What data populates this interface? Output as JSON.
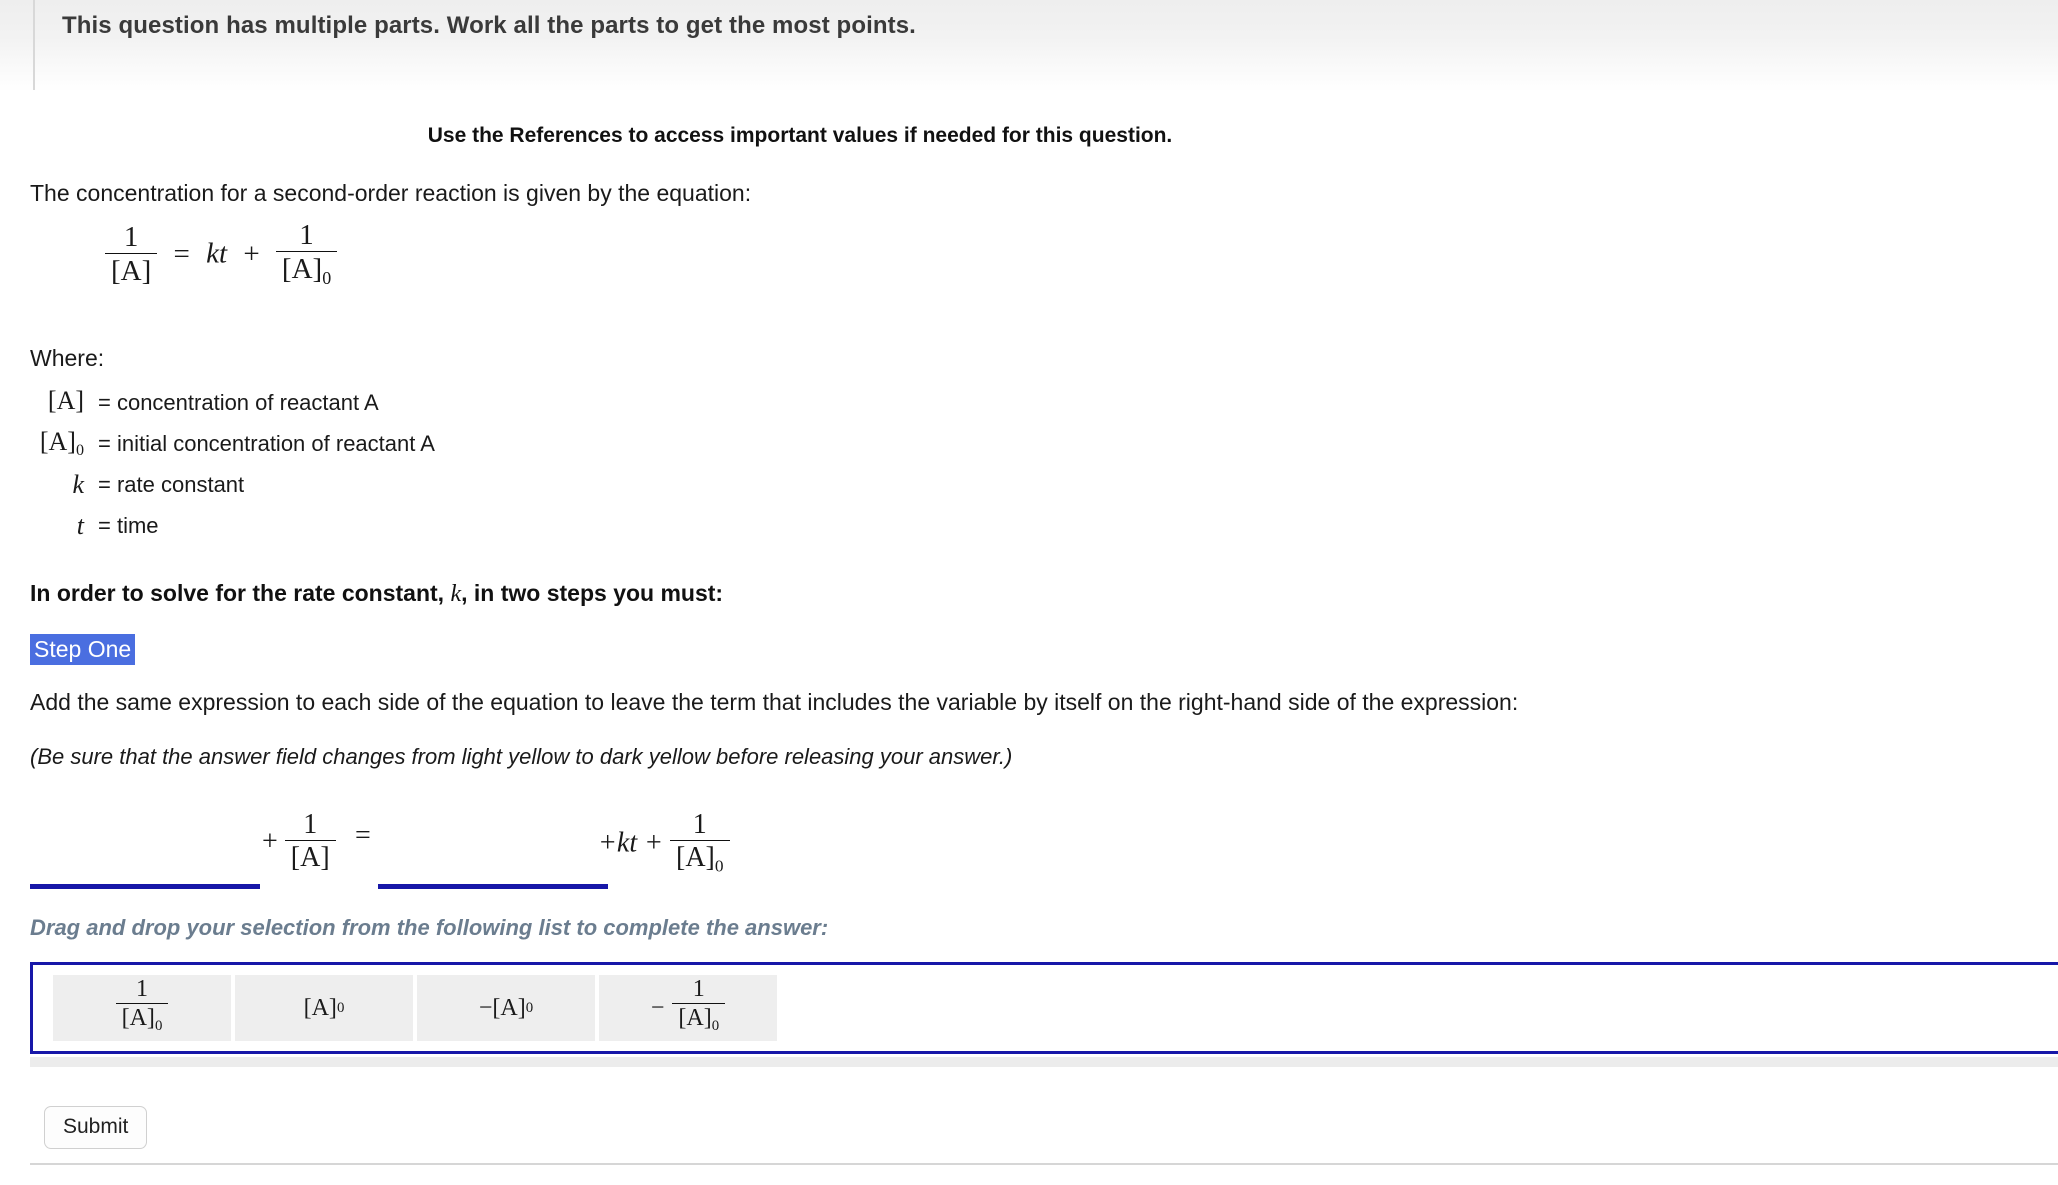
{
  "header": {
    "title": "This question has multiple parts. Work all the parts to get the most points."
  },
  "references": {
    "text": "Use the References to access important values if needed for this question."
  },
  "intro": {
    "text": "The concentration for a second-order reaction is given by the equation:",
    "equation_plain": "1/[A] = kt + 1/[A]0"
  },
  "equation": {
    "lhs_num": "1",
    "lhs_den": "[A]",
    "equals": "=",
    "kt": "kt",
    "plus": "+",
    "rhs_num": "1",
    "rhs_den_base": "[A]",
    "rhs_den_sub": "0"
  },
  "where": {
    "label": "Where:",
    "rows": [
      {
        "symbol": "[A]",
        "symbol_sub": "",
        "definition": "= concentration of reactant A"
      },
      {
        "symbol": "[A]",
        "symbol_sub": "0",
        "definition": "= initial concentration of reactant A"
      },
      {
        "symbol": "k",
        "symbol_sub": "",
        "definition": "= rate constant"
      },
      {
        "symbol": "t",
        "symbol_sub": "",
        "definition": "= time"
      }
    ]
  },
  "solve": {
    "head_before": "In order to solve for the rate constant,",
    "head_symbol": "k",
    "head_after": ", in two steps you must:",
    "step_label": "Step One",
    "instruction": "Add the same expression to each side of the equation to leave the term that includes the variable by itself on the right-hand side of the expression:",
    "note": "(Be sure that the answer field changes from light yellow to dark yellow before releasing your answer.)"
  },
  "answer_equation": {
    "blank_1_value": "",
    "blank_2_value": "",
    "lhs_plus": "+",
    "lhs_num": "1",
    "lhs_den": "[A]",
    "equals": "=",
    "rhs_plus_kt": "+kt +",
    "rhs_num": "1",
    "rhs_den_base": "[A]",
    "rhs_den_sub": "0"
  },
  "drag_drop": {
    "prompt": "Drag and drop your selection from the following list to complete the answer:",
    "tiles": [
      {
        "type": "fraction",
        "num": "1",
        "den_base": "[A]",
        "den_sub": "0",
        "sign": "",
        "label": "1/[A0]"
      },
      {
        "type": "plain",
        "base": "[A]",
        "sub": "0",
        "sign": "",
        "label": "[A0]"
      },
      {
        "type": "plain",
        "base": "[A]",
        "sub": "0",
        "sign": "−",
        "label": "-[A0]"
      },
      {
        "type": "fraction",
        "num": "1",
        "den_base": "[A]",
        "den_sub": "0",
        "sign": "−",
        "label": "-1/[A0]"
      }
    ]
  },
  "footer": {
    "submit_label": "Submit"
  },
  "colors": {
    "selection_highlight": "#4a6ee0",
    "blank_underline": "#1717a8",
    "tray_border": "#1717a8",
    "prompt_text": "#6b7d8f",
    "tile_background": "#eeeeee"
  }
}
